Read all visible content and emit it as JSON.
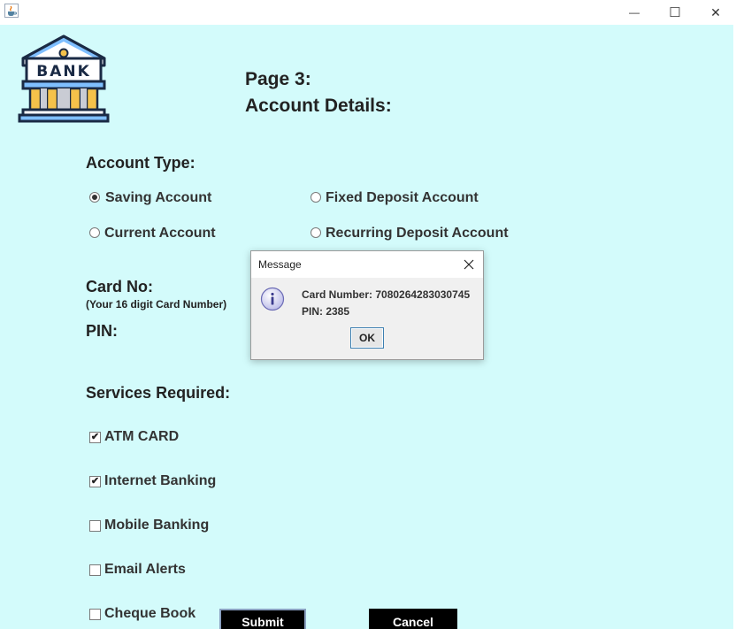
{
  "window": {
    "title_icon": "java-cup-icon",
    "minimize_glyph": "—",
    "maximize_glyph": "☐",
    "close_glyph": "✕"
  },
  "logo": {
    "text": "BANK"
  },
  "page": {
    "title_line1": "Page 3:",
    "title_line2": "Account Details:"
  },
  "account_type": {
    "label": "Account Type:",
    "options": [
      {
        "label": "Saving Account",
        "selected": true
      },
      {
        "label": "Fixed Deposit Account",
        "selected": false
      },
      {
        "label": "Current Account",
        "selected": false
      },
      {
        "label": "Recurring Deposit Account",
        "selected": false
      }
    ]
  },
  "card": {
    "label": "Card No:",
    "hint": "(Your 16 digit Card Number)"
  },
  "pin": {
    "label": "PIN:"
  },
  "services": {
    "label": "Services Required:",
    "items": [
      {
        "label": "ATM CARD",
        "checked": true
      },
      {
        "label": "Internet Banking",
        "checked": true
      },
      {
        "label": "Mobile Banking",
        "checked": false
      },
      {
        "label": "Email Alerts",
        "checked": false
      },
      {
        "label": "Cheque Book",
        "checked": false
      }
    ]
  },
  "buttons": {
    "submit": "Submit",
    "cancel": "Cancel"
  },
  "dialog": {
    "title": "Message",
    "line1": "Card Number: 7080264283030745",
    "line2": "PIN: 2385",
    "ok": "OK",
    "icon": "information-icon"
  },
  "colors": {
    "background": "#d3fbfb",
    "button_dark": "#000000"
  }
}
